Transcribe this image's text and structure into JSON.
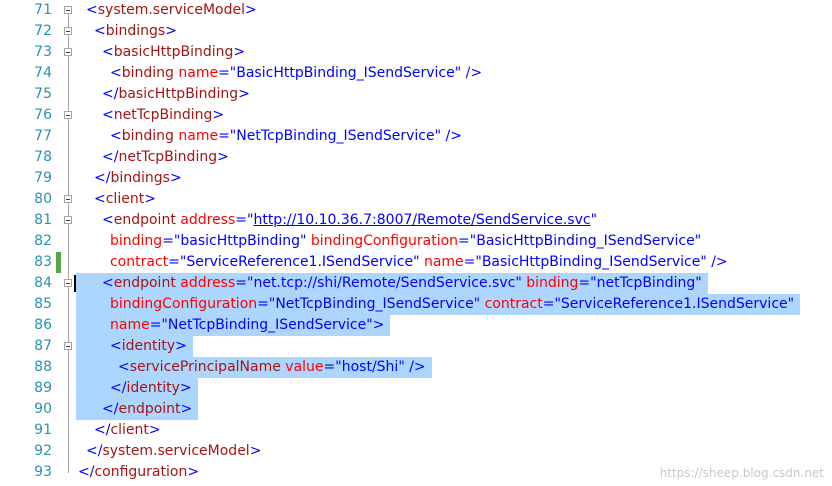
{
  "editor": {
    "lines": [
      {
        "n": "71",
        "ind": 86,
        "sel": false,
        "chg": false,
        "fold": "box",
        "tokens": [
          {
            "t": "<",
            "c": "pb"
          },
          {
            "t": "system.serviceModel",
            "c": "tg"
          },
          {
            "t": ">",
            "c": "pb"
          }
        ]
      },
      {
        "n": "72",
        "ind": 94,
        "sel": false,
        "chg": false,
        "fold": "box",
        "tokens": [
          {
            "t": "<",
            "c": "pb"
          },
          {
            "t": "bindings",
            "c": "tg"
          },
          {
            "t": ">",
            "c": "pb"
          }
        ]
      },
      {
        "n": "73",
        "ind": 102,
        "sel": false,
        "chg": false,
        "fold": "box",
        "tokens": [
          {
            "t": "<",
            "c": "pb"
          },
          {
            "t": "basicHttpBinding",
            "c": "tg"
          },
          {
            "t": ">",
            "c": "pb"
          }
        ]
      },
      {
        "n": "74",
        "ind": 110,
        "sel": false,
        "chg": false,
        "fold": "line",
        "tokens": [
          {
            "t": "<",
            "c": "pb"
          },
          {
            "t": "binding",
            "c": "tg"
          },
          {
            "t": " ",
            "c": ""
          },
          {
            "t": "name",
            "c": "at"
          },
          {
            "t": "=\"",
            "c": "pb"
          },
          {
            "t": "BasicHttpBinding_ISendService",
            "c": "vl"
          },
          {
            "t": "\" />",
            "c": "pb"
          }
        ]
      },
      {
        "n": "75",
        "ind": 102,
        "sel": false,
        "chg": false,
        "fold": "line",
        "tokens": [
          {
            "t": "</",
            "c": "pb"
          },
          {
            "t": "basicHttpBinding",
            "c": "tg"
          },
          {
            "t": ">",
            "c": "pb"
          }
        ]
      },
      {
        "n": "76",
        "ind": 102,
        "sel": false,
        "chg": false,
        "fold": "box",
        "tokens": [
          {
            "t": "<",
            "c": "pb"
          },
          {
            "t": "netTcpBinding",
            "c": "tg"
          },
          {
            "t": ">",
            "c": "pb"
          }
        ]
      },
      {
        "n": "77",
        "ind": 110,
        "sel": false,
        "chg": false,
        "fold": "line",
        "tokens": [
          {
            "t": "<",
            "c": "pb"
          },
          {
            "t": "binding",
            "c": "tg"
          },
          {
            "t": " ",
            "c": ""
          },
          {
            "t": "name",
            "c": "at"
          },
          {
            "t": "=\"",
            "c": "pb"
          },
          {
            "t": "NetTcpBinding_ISendService",
            "c": "vl"
          },
          {
            "t": "\" />",
            "c": "pb"
          }
        ]
      },
      {
        "n": "78",
        "ind": 102,
        "sel": false,
        "chg": false,
        "fold": "line",
        "tokens": [
          {
            "t": "</",
            "c": "pb"
          },
          {
            "t": "netTcpBinding",
            "c": "tg"
          },
          {
            "t": ">",
            "c": "pb"
          }
        ]
      },
      {
        "n": "79",
        "ind": 94,
        "sel": false,
        "chg": false,
        "fold": "line",
        "tokens": [
          {
            "t": "</",
            "c": "pb"
          },
          {
            "t": "bindings",
            "c": "tg"
          },
          {
            "t": ">",
            "c": "pb"
          }
        ]
      },
      {
        "n": "80",
        "ind": 94,
        "sel": false,
        "chg": false,
        "fold": "box",
        "tokens": [
          {
            "t": "<",
            "c": "pb"
          },
          {
            "t": "client",
            "c": "tg"
          },
          {
            "t": ">",
            "c": "pb"
          }
        ]
      },
      {
        "n": "81",
        "ind": 102,
        "sel": false,
        "chg": false,
        "fold": "box",
        "tokens": [
          {
            "t": "<",
            "c": "pb"
          },
          {
            "t": "endpoint",
            "c": "tg"
          },
          {
            "t": " ",
            "c": ""
          },
          {
            "t": "address",
            "c": "at"
          },
          {
            "t": "=\"",
            "c": "pb"
          },
          {
            "t": "http://10.10.36.7:8007/Remote/SendService.svc",
            "c": "url"
          },
          {
            "t": "\"",
            "c": "pb"
          }
        ]
      },
      {
        "n": "82",
        "ind": 110,
        "sel": false,
        "chg": false,
        "fold": "line",
        "tokens": [
          {
            "t": "binding",
            "c": "at"
          },
          {
            "t": "=\"",
            "c": "pb"
          },
          {
            "t": "basicHttpBinding",
            "c": "vl"
          },
          {
            "t": "\" ",
            "c": "pb"
          },
          {
            "t": "bindingConfiguration",
            "c": "at"
          },
          {
            "t": "=\"",
            "c": "pb"
          },
          {
            "t": "BasicHttpBinding_ISendService",
            "c": "vl"
          },
          {
            "t": "\"",
            "c": "pb"
          }
        ]
      },
      {
        "n": "83",
        "ind": 110,
        "sel": false,
        "chg": true,
        "fold": "line",
        "tokens": [
          {
            "t": "contract",
            "c": "at"
          },
          {
            "t": "=\"",
            "c": "pb"
          },
          {
            "t": "ServiceReference1.ISendService",
            "c": "vl"
          },
          {
            "t": "\" ",
            "c": "pb"
          },
          {
            "t": "name",
            "c": "at"
          },
          {
            "t": "=\"",
            "c": "pb"
          },
          {
            "t": "BasicHttpBinding_ISendService",
            "c": "vl"
          },
          {
            "t": "\" />",
            "c": "pb"
          }
        ]
      },
      {
        "n": "84",
        "ind": 102,
        "sel": true,
        "chg": false,
        "fold": "box",
        "caret": true,
        "tokens": [
          {
            "t": "<",
            "c": "pb"
          },
          {
            "t": "endpoint",
            "c": "tg"
          },
          {
            "t": " ",
            "c": ""
          },
          {
            "t": "address",
            "c": "at"
          },
          {
            "t": "=\"",
            "c": "pb"
          },
          {
            "t": "net.tcp://shi/Remote/SendService.svc",
            "c": "vl"
          },
          {
            "t": "\" ",
            "c": "pb"
          },
          {
            "t": "binding",
            "c": "at"
          },
          {
            "t": "=\"",
            "c": "pb"
          },
          {
            "t": "netTcpBinding",
            "c": "vl"
          },
          {
            "t": "\"",
            "c": "pb"
          }
        ]
      },
      {
        "n": "85",
        "ind": 110,
        "sel": true,
        "chg": false,
        "fold": "line",
        "tokens": [
          {
            "t": "bindingConfiguration",
            "c": "at"
          },
          {
            "t": "=\"",
            "c": "pb"
          },
          {
            "t": "NetTcpBinding_ISendService",
            "c": "vl"
          },
          {
            "t": "\" ",
            "c": "pb"
          },
          {
            "t": "contract",
            "c": "at"
          },
          {
            "t": "=\"",
            "c": "pb"
          },
          {
            "t": "ServiceReference1.ISendService",
            "c": "vl"
          },
          {
            "t": "\"",
            "c": "pb"
          }
        ]
      },
      {
        "n": "86",
        "ind": 110,
        "sel": true,
        "chg": false,
        "fold": "line",
        "tokens": [
          {
            "t": "name",
            "c": "at"
          },
          {
            "t": "=\"",
            "c": "pb"
          },
          {
            "t": "NetTcpBinding_ISendService",
            "c": "vl"
          },
          {
            "t": "\">",
            "c": "pb"
          }
        ]
      },
      {
        "n": "87",
        "ind": 110,
        "sel": true,
        "chg": false,
        "fold": "box",
        "tokens": [
          {
            "t": "<",
            "c": "pb"
          },
          {
            "t": "identity",
            "c": "tg"
          },
          {
            "t": ">",
            "c": "pb"
          }
        ]
      },
      {
        "n": "88",
        "ind": 118,
        "sel": true,
        "chg": false,
        "fold": "line",
        "tokens": [
          {
            "t": "<",
            "c": "pb"
          },
          {
            "t": "servicePrincipalName",
            "c": "tg"
          },
          {
            "t": " ",
            "c": ""
          },
          {
            "t": "value",
            "c": "at"
          },
          {
            "t": "=\"",
            "c": "pb"
          },
          {
            "t": "host/Shi",
            "c": "vl"
          },
          {
            "t": "\" />",
            "c": "pb"
          }
        ]
      },
      {
        "n": "89",
        "ind": 110,
        "sel": true,
        "chg": false,
        "fold": "line",
        "tokens": [
          {
            "t": "</",
            "c": "pb"
          },
          {
            "t": "identity",
            "c": "tg"
          },
          {
            "t": ">",
            "c": "pb"
          }
        ]
      },
      {
        "n": "90",
        "ind": 102,
        "sel": true,
        "chg": false,
        "fold": "line",
        "tokens": [
          {
            "t": "</",
            "c": "pb"
          },
          {
            "t": "endpoint",
            "c": "tg"
          },
          {
            "t": ">",
            "c": "pb"
          }
        ]
      },
      {
        "n": "91",
        "ind": 94,
        "sel": false,
        "chg": false,
        "fold": "line",
        "tokens": [
          {
            "t": "</",
            "c": "pb"
          },
          {
            "t": "client",
            "c": "tg"
          },
          {
            "t": ">",
            "c": "pb"
          }
        ]
      },
      {
        "n": "92",
        "ind": 86,
        "sel": false,
        "chg": false,
        "fold": "line",
        "tokens": [
          {
            "t": "</",
            "c": "pb"
          },
          {
            "t": "system.serviceModel",
            "c": "tg"
          },
          {
            "t": ">",
            "c": "pb"
          }
        ]
      },
      {
        "n": "93",
        "ind": 78,
        "sel": false,
        "chg": false,
        "fold": "half",
        "tokens": [
          {
            "t": "</",
            "c": "pb"
          },
          {
            "t": "configuration",
            "c": "tg"
          },
          {
            "t": ">",
            "c": "pb"
          }
        ]
      }
    ]
  },
  "watermark": "https://sheep.blog.csdn.net"
}
